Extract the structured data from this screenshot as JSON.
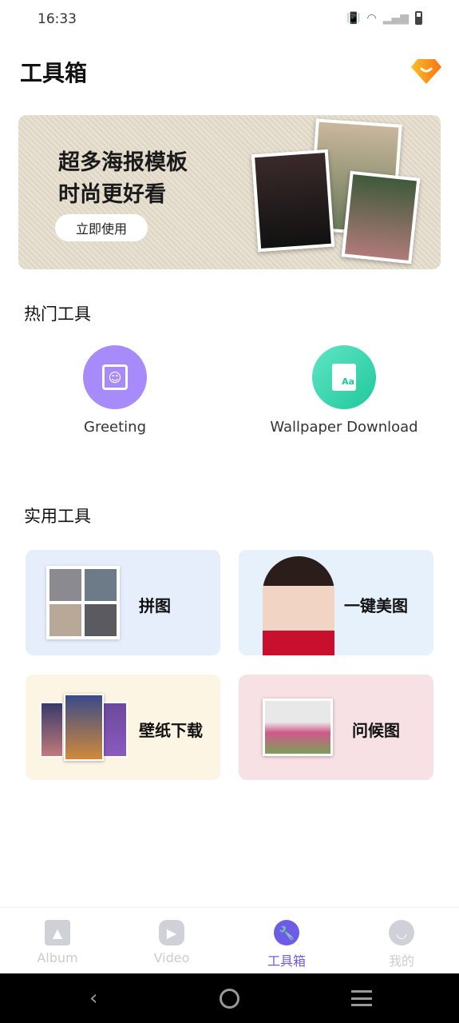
{
  "status": {
    "time": "16:33"
  },
  "header": {
    "title": "工具箱"
  },
  "banner": {
    "line1": "超多海报模板",
    "line2": "时尚更好看",
    "button": "立即使用"
  },
  "hot": {
    "title": "热门工具",
    "items": [
      {
        "label": "Greeting",
        "color": "#a78bfa"
      },
      {
        "label": "Wallpaper Download",
        "color": "#34d6b0"
      }
    ]
  },
  "practical": {
    "title": "实用工具",
    "items": [
      {
        "label": "拼图",
        "bg": "#e6eefc"
      },
      {
        "label": "一键美图",
        "bg": "#e6f1fc"
      },
      {
        "label": "壁纸下载",
        "bg": "#fcf5e4"
      },
      {
        "label": "问候图",
        "bg": "#f8e1e4"
      }
    ]
  },
  "nav": {
    "items": [
      {
        "label": "Album"
      },
      {
        "label": "Video"
      },
      {
        "label": "工具箱",
        "active": true
      },
      {
        "label": "我的"
      }
    ],
    "accent": "#6c5ce7"
  }
}
